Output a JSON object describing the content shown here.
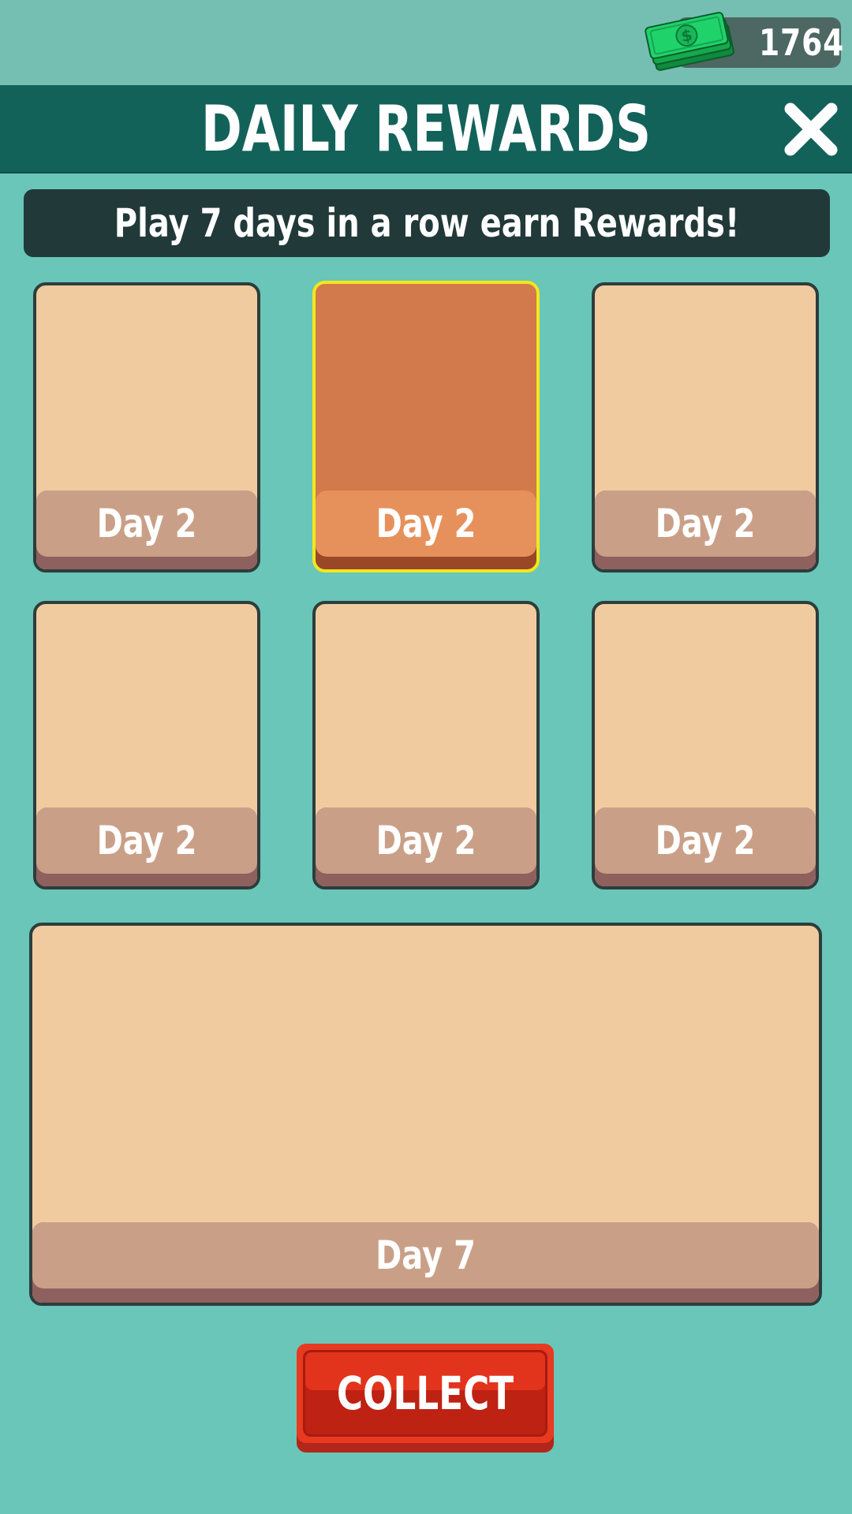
{
  "currency": {
    "amount": "1764",
    "icon": "cash-stack-icon",
    "color": "#1fd36a"
  },
  "header": {
    "title": "DAILY REWARDS",
    "close_icon": "close-icon"
  },
  "banner": {
    "text": "Play 7 days in a row earn Rewards!"
  },
  "days": [
    {
      "label": "Day 2",
      "selected": false
    },
    {
      "label": "Day 2",
      "selected": true
    },
    {
      "label": "Day 2",
      "selected": false
    },
    {
      "label": "Day 2",
      "selected": false
    },
    {
      "label": "Day 2",
      "selected": false
    },
    {
      "label": "Day 2",
      "selected": false
    },
    {
      "label": "Day 7",
      "selected": false
    }
  ],
  "collect_button": {
    "label": "COLLECT"
  },
  "colors": {
    "background": "#69c6b8",
    "header": "#13625a",
    "banner": "#22393a",
    "card": "#f0cb9f",
    "card_active": "#d27a4b",
    "card_active_border": "#f3e61c",
    "collect": "#e83a21"
  }
}
